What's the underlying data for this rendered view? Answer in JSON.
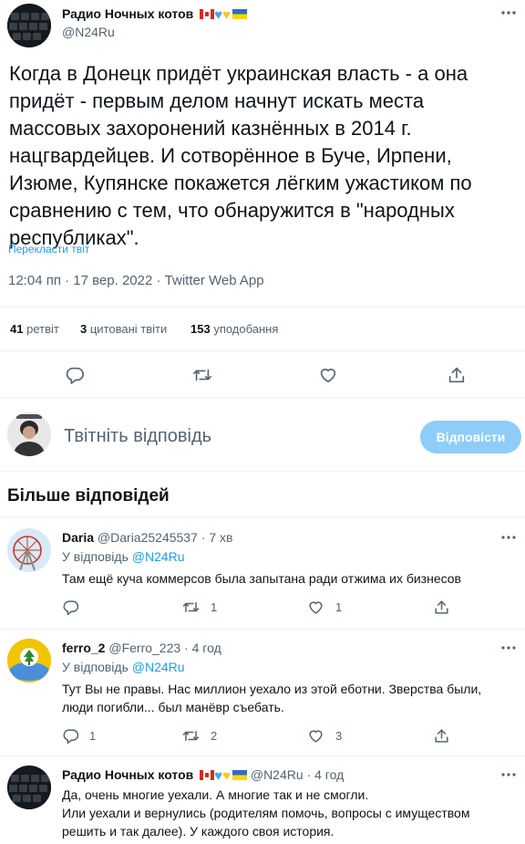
{
  "main_tweet": {
    "author_name": "Радио Ночных котов",
    "handle": "@N24Ru",
    "text": "Когда в Донецк придёт украинская власть - а она придёт - первым делом начнут искать места массовых захоронений казнённых в 2014 г. нацгвардейцев. И сотворённое в Буче, Ирпени, Изюме, Купянске покажется лёгким ужастиком по сравнению с тем, что обнаружится в \"народных республиках\".",
    "translate_label": "Перекласти твіт",
    "meta": "12:04 пп · 17 вер. 2022 · Twitter Web App",
    "stats": [
      {
        "value": "41",
        "label": "ретвіт"
      },
      {
        "value": "3",
        "label": "цитовані твіти"
      },
      {
        "value": "153",
        "label": "уподобання"
      }
    ],
    "actions": [
      "reply-icon",
      "retweet-icon",
      "like-icon",
      "share-icon"
    ]
  },
  "composer": {
    "placeholder": "Твітніть відповідь",
    "button_label": "Відповісти"
  },
  "more_replies_heading": "Більше відповідей",
  "replies": [
    {
      "author_name": "Daria",
      "handle": "@Daria25245537",
      "time": "7 хв",
      "reply_to_prefix": "У відповідь",
      "reply_to_handle": "@N24Ru",
      "text": "Там ещё куча коммерсов была запытана ради отжима их бизнесов",
      "reply_count": "",
      "retweet_count": "1",
      "like_count": "1"
    },
    {
      "author_name": "ferro_2",
      "handle": "@Ferro_223",
      "time": "4 год",
      "reply_to_prefix": "У відповідь",
      "reply_to_handle": "@N24Ru",
      "text_line1": "Тут Вы не правы. Нас миллион уехало из этой еботни. Зверства были,",
      "text_line2": "люди погибли... был манёвр съебать.",
      "reply_count": "1",
      "retweet_count": "2",
      "like_count": "3"
    },
    {
      "author_name": "Радио Ночных котов",
      "handle": "@N24Ru",
      "time": "4 год",
      "text_line1": "Да, очень многие уехали. А многие так и не смогли.",
      "text_line2": "Или уехали и вернулись (родителям помочь, вопросы с имуществом",
      "text_line3": "решить и так далее). У каждого своя история."
    }
  ],
  "colors": {
    "accent": "#1d9bf0",
    "accent_disabled": "#8ecdf8",
    "secondary_text": "#536471"
  }
}
